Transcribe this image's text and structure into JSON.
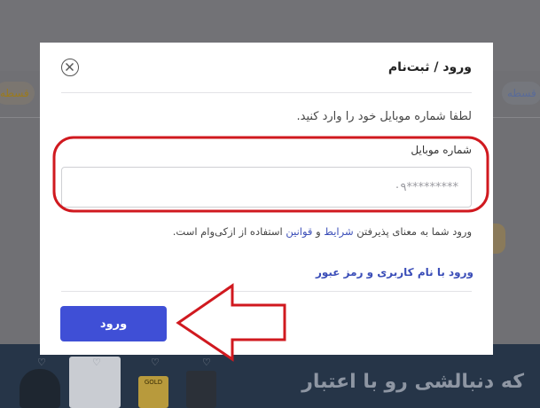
{
  "background": {
    "chip_left": "قسطه",
    "chip_right": "قسطه",
    "banner_text": "که دنبالشی رو با اعتبار",
    "product_box_text": "GOLD"
  },
  "modal": {
    "title": "ورود / ثبت‌نام",
    "close_icon": "close-circle-icon",
    "instruction": "لطفا شماره موبایل خود را وارد کنید.",
    "phone": {
      "label": "شماره موبایل",
      "placeholder": "۰۹*********",
      "value": ""
    },
    "terms": {
      "prefix": "ورود شما به معنای پذیرفتن ",
      "link1": "شرایط",
      "middle": " و ",
      "link2": "قوانین",
      "suffix": " استفاده از ازکی‌وام است."
    },
    "alt_login": "ورود با نام کاربری و رمز عبور",
    "submit_label": "ورود"
  },
  "annotations": {
    "highlight_color": "#d0191f",
    "arrow_color": "#d0191f"
  },
  "colors": {
    "primary": "#3f4fd6",
    "link": "#3b4eb8"
  }
}
